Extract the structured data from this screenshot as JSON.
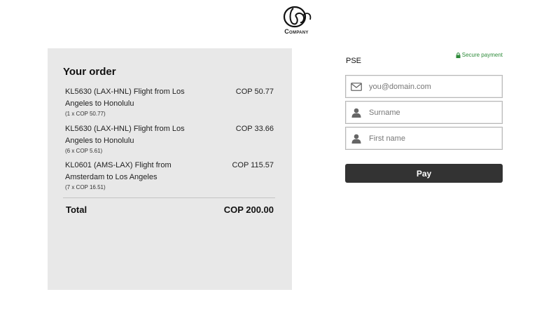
{
  "brand": {
    "logo_text": "Company"
  },
  "order": {
    "title": "Your order",
    "items": [
      {
        "name": "KL5630 (LAX-HNL) Flight from Los Angeles to Honolulu",
        "price": "COP 50.77",
        "qty": "(1 x COP 50.77)"
      },
      {
        "name": "KL5630 (LAX-HNL) Flight from Los Angeles to Honolulu",
        "price": "COP 33.66",
        "qty": "(6 x COP 5.61)"
      },
      {
        "name": "KL0601 (AMS-LAX) Flight from Amsterdam to Los Angeles",
        "price": "COP 115.57",
        "qty": "(7 x COP 16.51)"
      }
    ],
    "total_label": "Total",
    "total_value": "COP 200.00"
  },
  "payment": {
    "method": "PSE",
    "secure_label": "Secure payment",
    "email_placeholder": "you@domain.com",
    "surname_placeholder": "Surname",
    "firstname_placeholder": "First name",
    "pay_label": "Pay"
  },
  "icons": {
    "email": "envelope-icon",
    "surname": "person-icon",
    "firstname": "person-icon",
    "secure": "lock-icon"
  },
  "colors": {
    "panel_bg": "#e8e8e8",
    "pay_button": "#333333",
    "secure_text": "#2e8b3a"
  }
}
